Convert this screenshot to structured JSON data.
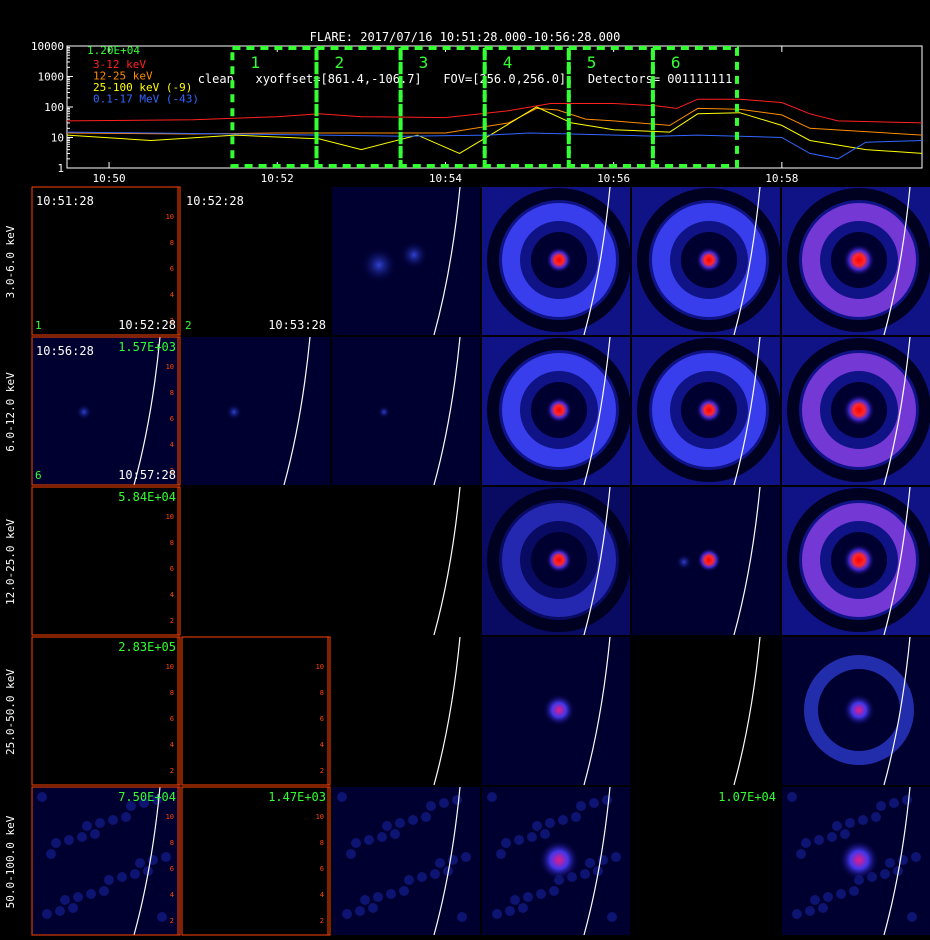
{
  "header": {
    "line1": "FLARE: 2017/07/16 10:51:28.000-10:56:28.000",
    "line2": "clean   xyoffset=[861.4,-106.7]   FOV=[256.0,256.0]   Detectors= 001111111"
  },
  "colors": {
    "frame": "#ff4500",
    "interval_box": "#33ff33",
    "red": "#ff2020",
    "orange": "#ff8c00",
    "yellow": "#ffff00",
    "blue": "#3366ff",
    "green_text": "#33ff33",
    "limb": "#ffffff"
  },
  "chart_data": [
    {
      "type": "line",
      "yscale": "log",
      "ylim": [
        1,
        10000
      ],
      "xlim": [
        "10:49:30",
        "10:59:40"
      ],
      "y_ticks": [
        "1",
        "10",
        "100",
        "1000",
        "10000"
      ],
      "x_ticks": [
        "10:50",
        "10:52",
        "10:54",
        "10:56",
        "10:58"
      ],
      "top_label": "1.20E+04",
      "series": [
        {
          "name": "3-12 keV",
          "color": "#ff2020",
          "points": [
            [
              "10:49:30",
              35
            ],
            [
              "10:51:00",
              38
            ],
            [
              "10:52:00",
              48
            ],
            [
              "10:52:30",
              60
            ],
            [
              "10:53:00",
              48
            ],
            [
              "10:54:00",
              45
            ],
            [
              "10:54:45",
              75
            ],
            [
              "10:55:15",
              130
            ],
            [
              "10:56:00",
              130
            ],
            [
              "10:56:30",
              110
            ],
            [
              "10:56:45",
              90
            ],
            [
              "10:57:00",
              180
            ],
            [
              "10:57:30",
              180
            ],
            [
              "10:58:00",
              140
            ],
            [
              "10:58:20",
              60
            ],
            [
              "10:58:40",
              35
            ],
            [
              "10:59:40",
              30
            ]
          ]
        },
        {
          "name": "12-25 keV",
          "color": "#ff8c00",
          "points": [
            [
              "10:49:30",
              14
            ],
            [
              "10:51:00",
              13
            ],
            [
              "10:52:00",
              14
            ],
            [
              "10:53:00",
              14
            ],
            [
              "10:54:00",
              14
            ],
            [
              "10:54:45",
              30
            ],
            [
              "10:55:05",
              90
            ],
            [
              "10:55:20",
              80
            ],
            [
              "10:55:40",
              40
            ],
            [
              "10:56:00",
              35
            ],
            [
              "10:56:40",
              25
            ],
            [
              "10:57:00",
              90
            ],
            [
              "10:57:30",
              85
            ],
            [
              "10:58:00",
              55
            ],
            [
              "10:58:20",
              20
            ],
            [
              "10:59:40",
              12
            ]
          ]
        },
        {
          "name": "25-100 keV (-9)",
          "color": "#ffff00",
          "points": [
            [
              "10:49:30",
              12
            ],
            [
              "10:50:30",
              8
            ],
            [
              "10:51:30",
              12
            ],
            [
              "10:52:30",
              9
            ],
            [
              "10:53:00",
              4
            ],
            [
              "10:53:40",
              12
            ],
            [
              "10:54:10",
              3
            ],
            [
              "10:54:40",
              20
            ],
            [
              "10:55:05",
              100
            ],
            [
              "10:55:30",
              30
            ],
            [
              "10:56:00",
              18
            ],
            [
              "10:56:40",
              15
            ],
            [
              "10:57:00",
              60
            ],
            [
              "10:57:30",
              65
            ],
            [
              "10:58:00",
              25
            ],
            [
              "10:58:20",
              8
            ],
            [
              "10:59:00",
              4
            ],
            [
              "10:59:40",
              3
            ]
          ]
        },
        {
          "name": "0.1-17 MeV (-43)",
          "color": "#3366ff",
          "points": [
            [
              "10:49:30",
              15
            ],
            [
              "10:50:30",
              14
            ],
            [
              "10:51:30",
              13
            ],
            [
              "10:52:30",
              12
            ],
            [
              "10:53:30",
              11
            ],
            [
              "10:54:30",
              12
            ],
            [
              "10:55:00",
              14
            ],
            [
              "10:55:30",
              13
            ],
            [
              "10:56:30",
              11
            ],
            [
              "10:57:00",
              12
            ],
            [
              "10:57:30",
              11
            ],
            [
              "10:58:00",
              10
            ],
            [
              "10:58:20",
              3
            ],
            [
              "10:58:40",
              2
            ],
            [
              "10:59:00",
              7
            ],
            [
              "10:59:40",
              8
            ]
          ]
        }
      ],
      "intervals": [
        {
          "label": "1",
          "start": "10:51:28",
          "end": "10:52:28"
        },
        {
          "label": "2",
          "start": "10:52:28",
          "end": "10:53:28"
        },
        {
          "label": "3",
          "start": "10:53:28",
          "end": "10:54:28"
        },
        {
          "label": "4",
          "start": "10:54:28",
          "end": "10:55:28"
        },
        {
          "label": "5",
          "start": "10:55:28",
          "end": "10:56:28"
        },
        {
          "label": "6",
          "start": "10:56:28",
          "end": "10:57:28"
        }
      ]
    },
    {
      "type": "heatmap",
      "rows": [
        "3.0-6.0 keV",
        "6.0-12.0 keV",
        "12.0-25.0 keV",
        "25.0-50.0 keV",
        "50.0-100.0 keV"
      ],
      "cols": 6,
      "axis_ticks": [
        "2",
        "4",
        "6",
        "8",
        "10"
      ],
      "cells": [
        [
          {
            "pattern": "empty",
            "t1": "10:51:28",
            "t2": "10:52:28",
            "num": "1"
          },
          {
            "pattern": "empty",
            "t1": "10:52:28",
            "t2": "10:53:28",
            "num": "2"
          },
          {
            "pattern": "faint",
            "limb": true
          },
          {
            "pattern": "ring",
            "limb": true
          },
          {
            "pattern": "ring",
            "limb": true
          },
          {
            "pattern": "ring_strong",
            "limb": true
          }
        ],
        [
          {
            "pattern": "dot",
            "t1": "10:56:28",
            "t2": "10:57:28",
            "num": "6",
            "peak": "1.57E+03",
            "limb": true
          },
          {
            "pattern": "dot",
            "limb": true
          },
          {
            "pattern": "dot_small",
            "limb": true
          },
          {
            "pattern": "ring",
            "limb": true
          },
          {
            "pattern": "ring",
            "limb": true
          },
          {
            "pattern": "ring_strong",
            "limb": true
          }
        ],
        [
          {
            "pattern": "empty",
            "peak": "5.84E+04"
          },
          {
            "pattern": "empty"
          },
          {
            "pattern": "empty",
            "limb": true
          },
          {
            "pattern": "ring_faint",
            "limb": true
          },
          {
            "pattern": "dot",
            "limb": true
          },
          {
            "pattern": "ring_strong",
            "limb": true
          }
        ],
        [
          {
            "pattern": "empty",
            "peak": "2.83E+05"
          },
          {
            "pattern": "empty"
          },
          {
            "pattern": "empty",
            "limb": true
          },
          {
            "pattern": "blob",
            "limb": true
          },
          {
            "pattern": "empty",
            "limb": true
          },
          {
            "pattern": "blob_ring",
            "limb": true
          }
        ],
        [
          {
            "pattern": "noise",
            "peak": "7.50E+04",
            "limb": true
          },
          {
            "pattern": "empty",
            "peak": "1.47E+03"
          },
          {
            "pattern": "noise",
            "limb": true
          },
          {
            "pattern": "blob_noise",
            "limb": true
          },
          {
            "pattern": "empty",
            "peak": "1.07E+04"
          },
          {
            "pattern": "blob_noise",
            "limb": true
          }
        ]
      ]
    }
  ]
}
